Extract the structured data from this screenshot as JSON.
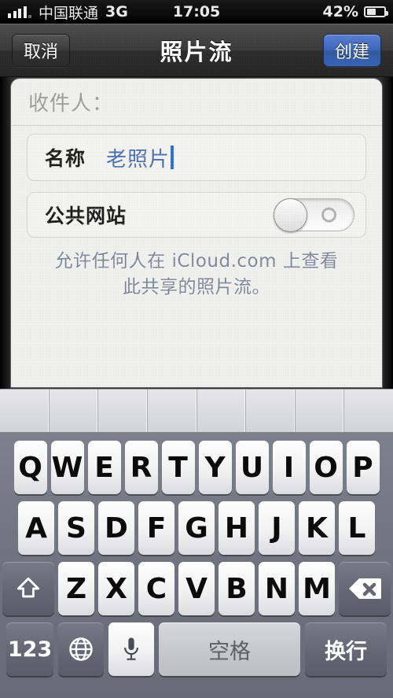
{
  "statusbar": {
    "carrier": "中国联通",
    "network": "3G",
    "time": "17:05",
    "battery_percent": "42%",
    "signal_icon": "signal-bars-icon",
    "battery_icon": "battery-icon"
  },
  "navbar": {
    "cancel_label": "取消",
    "title": "照片流",
    "create_label": "创建",
    "create_color": "#3c65bf"
  },
  "form": {
    "recipients_label": "收件人：",
    "name_label": "名称",
    "name_value": "老照片",
    "name_value_color": "#4a6fae",
    "public_site_label": "公共网站",
    "public_site_state": "off",
    "footnote": "允许任何人在 iCloud.com 上查看此共享的照片流。"
  },
  "suggestions": [
    "",
    "",
    "",
    "",
    "",
    "",
    "",
    ""
  ],
  "keyboard": {
    "row1": [
      "Q",
      "W",
      "E",
      "R",
      "T",
      "Y",
      "U",
      "I",
      "O",
      "P"
    ],
    "row2": [
      "A",
      "S",
      "D",
      "F",
      "G",
      "H",
      "J",
      "K",
      "L"
    ],
    "row3": [
      "Z",
      "X",
      "C",
      "V",
      "B",
      "N",
      "M"
    ],
    "shift_icon": "shift-arrow-icon",
    "delete_icon": "backspace-delete-icon",
    "numeric_label": "123",
    "globe_icon": "globe-language-icon",
    "mic_icon": "microphone-icon",
    "space_label": "空格",
    "return_label": "换行"
  }
}
